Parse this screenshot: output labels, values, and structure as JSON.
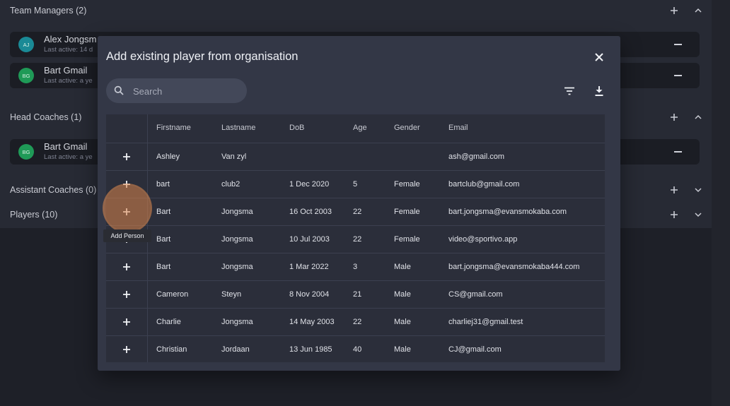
{
  "sections": {
    "team_managers": {
      "title": "Team Managers (2)"
    },
    "head_coaches": {
      "title": "Head Coaches (1)"
    },
    "assistant_coaches": {
      "title": "Assistant Coaches (0)"
    },
    "players": {
      "title": "Players (10)"
    }
  },
  "members": [
    {
      "initials": "AJ",
      "name": "Alex Jongsm",
      "sub": "Last active: 14 d",
      "avatar_color": "#1a8a96"
    },
    {
      "initials": "BG",
      "name": "Bart Gmail",
      "sub": "Last active: a ye",
      "avatar_color": "#1f9a57"
    },
    {
      "initials": "BG",
      "name": "Bart Gmail",
      "sub": "Last active: a ye",
      "avatar_color": "#1f9a57"
    }
  ],
  "modal": {
    "title": "Add existing player from organisation",
    "search_placeholder": "Search",
    "icons": {
      "close": "close-icon",
      "search": "search-icon",
      "filter": "filter-icon",
      "download": "download-icon",
      "add": "plus-icon"
    }
  },
  "table": {
    "columns": [
      "Firstname",
      "Lastname",
      "DoB",
      "Age",
      "Gender",
      "Email"
    ],
    "rows": [
      [
        "Ashley",
        "Van zyl",
        "",
        "",
        "",
        "ash@gmail.com"
      ],
      [
        "bart",
        "club2",
        "1 Dec 2020",
        "5",
        "Female",
        "bartclub@gmail.com"
      ],
      [
        "Bart",
        "Jongsma",
        "16 Oct 2003",
        "22",
        "Female",
        "bart.jongsma@evansmokaba.com"
      ],
      [
        "Bart",
        "Jongsma",
        "10 Jul 2003",
        "22",
        "Female",
        "video@sportivo.app"
      ],
      [
        "Bart",
        "Jongsma",
        "1 Mar 2022",
        "3",
        "Male",
        "bart.jongsma@evansmokaba444.com"
      ],
      [
        "Cameron",
        "Steyn",
        "8 Nov 2004",
        "21",
        "Male",
        "CS@gmail.com"
      ],
      [
        "Charlie",
        "Jongsma",
        "14 May 2003",
        "22",
        "Male",
        "charliej31@gmail.test"
      ],
      [
        "Christian",
        "Jordaan",
        "13 Jun 1985",
        "40",
        "Male",
        "CJ@gmail.com"
      ]
    ]
  },
  "tooltip": {
    "text": "Add Person"
  },
  "colors": {
    "accent_highlight": "#db854a",
    "modal_bg": "#333746",
    "page_bg": "#1e2028"
  }
}
